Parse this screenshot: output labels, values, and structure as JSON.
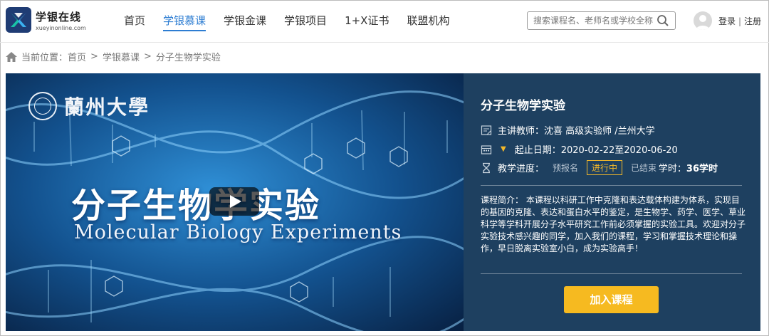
{
  "brand": {
    "name_cn": "学银在线",
    "name_en": "xueyinonline.com",
    "color": "#1f3c74"
  },
  "nav": {
    "items": [
      {
        "label": "首页",
        "active": false
      },
      {
        "label": "学银慕课",
        "active": true
      },
      {
        "label": "学银金课",
        "active": false
      },
      {
        "label": "学银项目",
        "active": false
      },
      {
        "label": "1+X证书",
        "active": false
      },
      {
        "label": "联盟机构",
        "active": false
      }
    ],
    "accent": "#2d7dd2"
  },
  "search": {
    "placeholder": "搜索课程名、老师名或学校全称",
    "icon": "search-icon"
  },
  "user": {
    "login": "登录",
    "separator": "|",
    "register": "注册",
    "icon": "avatar-icon"
  },
  "breadcrumb": {
    "prefix": "当前位置：",
    "items": [
      "首页",
      "学银慕课",
      "分子生物学实验"
    ],
    "separator": ">",
    "icon": "home-icon"
  },
  "banner": {
    "university": "蘭州大學",
    "course_cn": "分子生物学实验",
    "course_en": "Molecular Biology Experiments",
    "play_icon": "play-icon"
  },
  "course": {
    "title": "分子生物学实验",
    "teacher_label": "主讲教师：",
    "teacher": "沈喜 高级实验师 /兰州大学",
    "date_label": "起止日期：",
    "date": "2020-02-22至2020-06-20",
    "progress_label": "教学进度：",
    "progress_steps": [
      "预报名",
      "进行中",
      "已结束"
    ],
    "progress_current": "进行中",
    "hours_label": "学时：",
    "hours": "36学时",
    "intro": "课程简介：  本课程以科研工作中克隆和表达载体构建为体系，实现目的基因的克隆、表达和蛋白水平的鉴定，是生物学、药学、医学、草业科学等学科开展分子水平研究工作前必须掌握的实验工具。欢迎对分子实验技术感兴趣的同学，加入我们的课程，学习和掌握技术理论和操作，早日脱离实验室小白，成为实验高手！",
    "join_label": "加入课程",
    "panel_color": "#1e4060",
    "button_color": "#f6ba20"
  }
}
